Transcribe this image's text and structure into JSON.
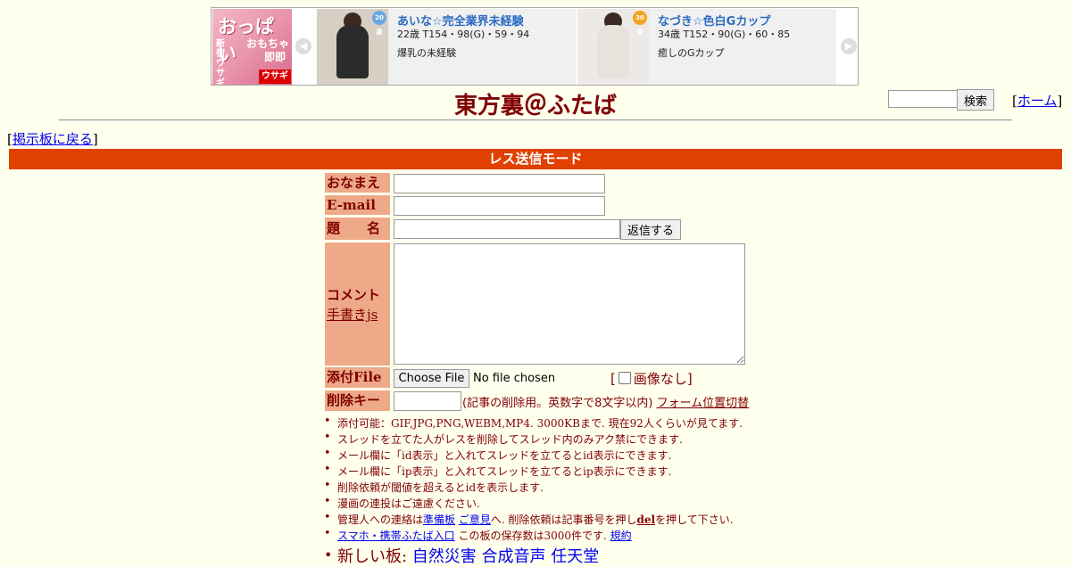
{
  "ad": {
    "left_banner": {
      "line1": "おっぱい",
      "line2": "おもちゃ",
      "line3": "即即",
      "side": "新宿ウサギ",
      "logo": "ウサギ"
    },
    "cards": [
      {
        "name": "あいな☆完全業界未経験",
        "spec": "22歳 T154・98(G)・59・94",
        "desc": "爆乳の未経験",
        "badge": "20歳",
        "badge_color": "#6aa6e0"
      },
      {
        "name": "なづき☆色白Gカップ",
        "spec": "34歳 T152・90(G)・60・85",
        "desc": "癒しのGカップ",
        "badge": "30歳",
        "badge_color": "#f2a322"
      }
    ],
    "prev_arrow": "◀",
    "next_arrow": "▶"
  },
  "header": {
    "title": "東方裏＠ふたば",
    "search_button": "検索",
    "home_link": "ホーム",
    "back_link": "掲示板に戻る"
  },
  "form": {
    "mode_title": "レス送信モード",
    "labels": {
      "name": "おなまえ",
      "email": "E-mail",
      "subject": "題　　名",
      "comment": "コメント",
      "handwriting": "手書きjs",
      "file": "添付File",
      "delete_key": "削除キー"
    },
    "submit_label": "返信する",
    "file_button": "Choose File",
    "file_status": "No file chosen",
    "no_image": "画像なし",
    "delete_note": "(記事の削除用。英数字で8文字以内)",
    "form_toggle": "フォーム位置切替"
  },
  "notes": {
    "n1": "添付可能：GIF,JPG,PNG,WEBM,MP4. 3000KBまで. 現在92人くらいが見てます.",
    "n2": "スレッドを立てた人がレスを削除してスレッド内のみアク禁にできます.",
    "n3": "メール欄に「id表示」と入れてスレッドを立てるとid表示にできます.",
    "n4": "メール欄に「ip表示」と入れてスレッドを立てるとip表示にできます.",
    "n5": "削除依頼が閾値を超えるとidを表示します.",
    "n6": "漫画の連投はご遠慮ください.",
    "n7_pre": "管理人への連絡は",
    "n7_link1": "準備板",
    "n7_link2": "ご意見",
    "n7_mid": "へ. 削除依頼は記事番号を押し",
    "n7_del": "del",
    "n7_post": "を押して下さい.",
    "n8_link": "スマホ・携帯ふたば入口",
    "n8_mid": " この板の保存数は3000件です. ",
    "n8_rules": "規約",
    "n9_pre": "新しい板: ",
    "n9_links": [
      "自然災害",
      "合成音声",
      "任天堂"
    ]
  },
  "colors": {
    "accent": "#e04000",
    "label_bg": "#eeaa88",
    "text": "#800000",
    "background": "#ffffee"
  }
}
